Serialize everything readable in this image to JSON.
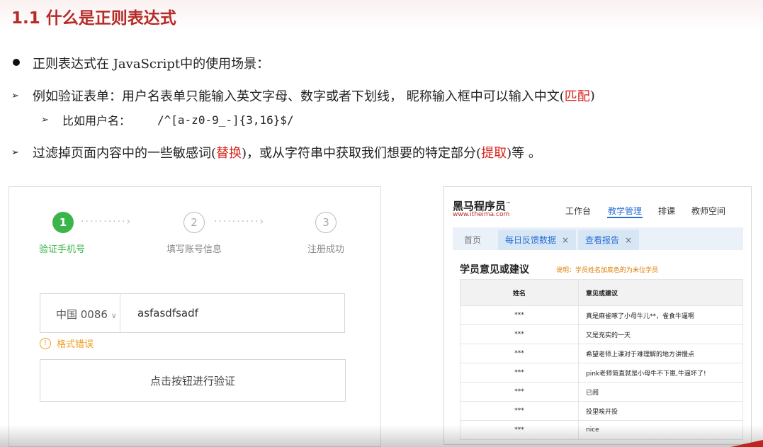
{
  "slide": {
    "title": "1.1 什么是正则表达式",
    "bullets": [
      {
        "text": "正则表达式在 JavaScript中的使用场景："
      },
      {
        "text_before": "例如验证表单：用户名表单只能输入英文字母、数字或者下划线， 昵称输入框中可以输入中文(",
        "highlight": "匹配",
        "text_after": ")"
      },
      {
        "text": "比如用户名：",
        "code": "/^[a-z0-9_-]{3,16}$/"
      },
      {
        "text_before": "过滤掉页面内容中的一些敏感词(",
        "highlight": "替换",
        "text_mid": ")，或从字符串中获取我们想要的特定部分(",
        "highlight2": "提取",
        "text_after": ")等 。"
      }
    ]
  },
  "register_form": {
    "steps": [
      {
        "number": "1",
        "label": "验证手机号",
        "state": "active"
      },
      {
        "number": "2",
        "label": "填写账号信息",
        "state": "idle"
      },
      {
        "number": "3",
        "label": "注册成功",
        "state": "idle"
      }
    ],
    "country": "中国 0086",
    "phone_value": "asfasdfsadf",
    "error_icon": "!",
    "error": "格式错误",
    "verify_button": "点击按钮进行验证"
  },
  "admin_panel": {
    "brand": "黑马程序员",
    "brand_tm": "™",
    "brand_url": "www.itheima.com",
    "nav": [
      "工作台",
      "教学管理",
      "排课",
      "教师空间"
    ],
    "nav_active": 1,
    "tabs": [
      "首页",
      "每日反馈数据",
      "查看报告"
    ],
    "section_title": "学员意见或建议",
    "note": "说明：学员姓名加底色的为未位学员",
    "columns": [
      "姓名",
      "意见或建议"
    ],
    "rows": [
      [
        "***",
        "真是麻雀啄了小母牛儿**，雀食牛逼啊"
      ],
      [
        "***",
        "又是充实的一天"
      ],
      [
        "***",
        "希望老师上课对于难理解的地方讲慢点"
      ],
      [
        "***",
        "pink老师简直就是小母牛不下崽,牛逼坏了!"
      ],
      [
        "***",
        "已阅"
      ],
      [
        "***",
        "投里唉开投"
      ],
      [
        "***",
        "nice"
      ]
    ]
  },
  "colors": {
    "accent": "#b52b27",
    "green": "#3ab54a",
    "blue": "#2a6fd6",
    "warning": "#f0a020"
  }
}
